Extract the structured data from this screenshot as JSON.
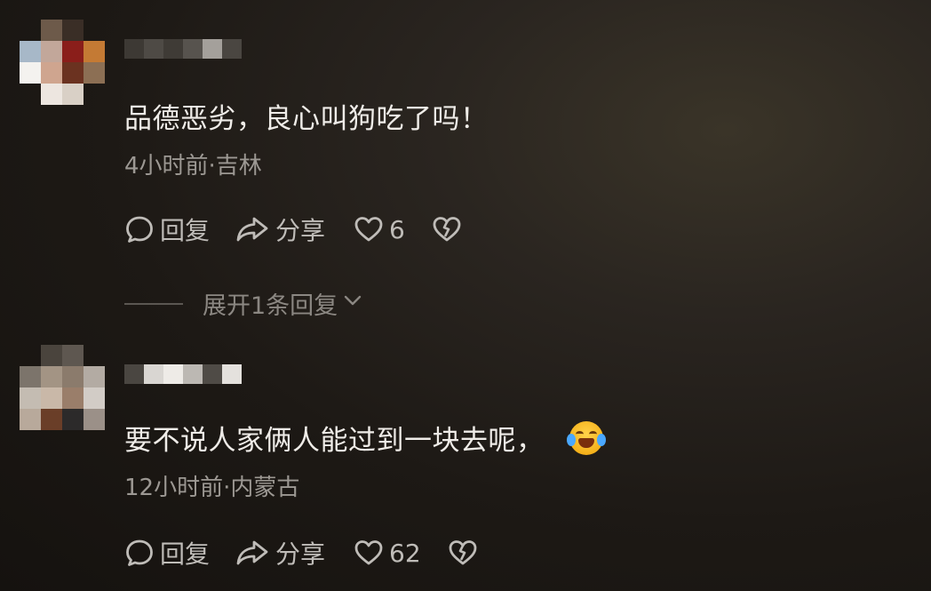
{
  "comments": [
    {
      "text": "品德恶劣，良心叫狗吃了吗！",
      "meta": "4小时前·吉林",
      "reply_label": "回复",
      "share_label": "分享",
      "likes": "6",
      "has_emoji": false
    },
    {
      "text": "要不说人家俩人能过到一块去呢，",
      "emoji": "tears-of-joy-emoji",
      "meta": "12小时前·内蒙古",
      "reply_label": "回复",
      "share_label": "分享",
      "likes": "62",
      "has_emoji": true
    }
  ],
  "expand_replies_label": "展开1条回复",
  "icons": {
    "reply": "comment-bubble-icon",
    "share": "share-arrow-icon",
    "like": "heart-icon",
    "dislike": "broken-heart-icon",
    "expand": "chevron-down-icon"
  },
  "colors": {
    "background": "#1d1915",
    "text_primary": "#efece8",
    "text_meta": "#9c9893",
    "action": "#bfbcb8"
  }
}
